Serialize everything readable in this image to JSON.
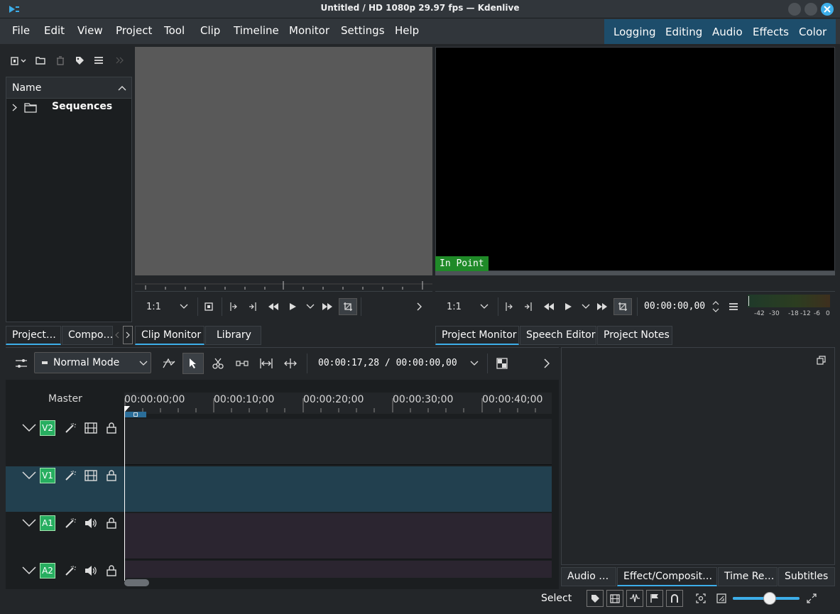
{
  "window": {
    "title": "Untitled / HD 1080p 29.97 fps — Kdenlive"
  },
  "menubar": {
    "items": [
      "File",
      "Edit",
      "View",
      "Project",
      "Tool",
      "Clip",
      "Timeline",
      "Monitor",
      "Settings",
      "Help"
    ]
  },
  "layouts": {
    "items": [
      "Logging",
      "Editing",
      "Audio",
      "Effects",
      "Color"
    ]
  },
  "bin": {
    "column_header": "Name",
    "items": [
      {
        "label": "Sequences"
      }
    ]
  },
  "left_tabs": [
    "Project…",
    "Compo…"
  ],
  "clip_monitor": {
    "zoom": "1:1"
  },
  "clip_tabs": [
    "Clip Monitor",
    "Library"
  ],
  "project_monitor": {
    "zoom": "1:1",
    "badge": "In Point",
    "timecode": "00:00:00,00",
    "vu_labels": [
      "-42",
      "-30",
      "-18",
      "-12",
      "-6",
      "0"
    ]
  },
  "project_tabs": [
    "Project Monitor",
    "Speech Editor",
    "Project Notes"
  ],
  "timeline": {
    "mode": "Normal Mode",
    "timecode": "00:00:17,28 / 00:00:00,00",
    "master_label": "Master",
    "ruler": [
      "00:00:00;00",
      "00:00:10;00",
      "00:00:20;00",
      "00:00:30;00",
      "00:00:40;00"
    ],
    "tracks": [
      {
        "name": "V2",
        "type": "video"
      },
      {
        "name": "V1",
        "type": "video"
      },
      {
        "name": "A1",
        "type": "audio"
      },
      {
        "name": "A2",
        "type": "audio"
      }
    ]
  },
  "right_tabs": [
    "Audio …",
    "Effect/Composit…",
    "Time Re…",
    "Subtitles"
  ],
  "statusbar": {
    "tool": "Select",
    "zoom_level": 0.55
  },
  "colors": {
    "accent": "#3daee9",
    "track_label": "#27ae60",
    "in_point": "#1f8a28",
    "layout_bar": "#1d4d6b"
  }
}
